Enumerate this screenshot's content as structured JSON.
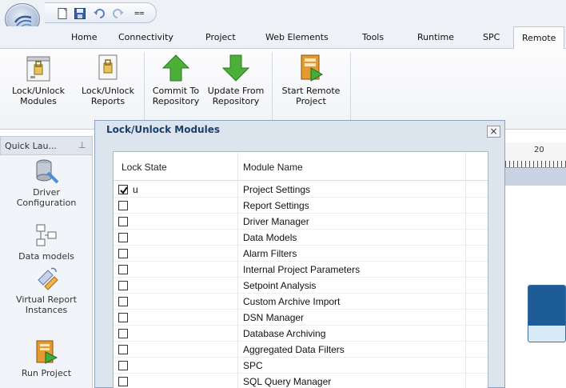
{
  "qat": {
    "icons": [
      "new-document-icon",
      "save-icon",
      "undo-icon",
      "redo-icon",
      "customize-dropdown-icon"
    ],
    "customize_glyph": "⩵"
  },
  "tabs": [
    {
      "label": "Home"
    },
    {
      "label": "Connectivity"
    },
    {
      "label": "Project"
    },
    {
      "label": "Web Elements"
    },
    {
      "label": "Tools"
    },
    {
      "label": "Runtime"
    },
    {
      "label": "SPC"
    },
    {
      "label": "Remote"
    }
  ],
  "ribbon": {
    "buttons": [
      {
        "line1": "Lock/Unlock",
        "line2": "Modules",
        "icon": "lock-modules-icon"
      },
      {
        "line1": "Lock/Unlock",
        "line2": "Reports",
        "icon": "lock-reports-icon"
      },
      {
        "line1": "Commit To",
        "line2": "Repository",
        "icon": "commit-up-arrow-icon"
      },
      {
        "line1": "Update From",
        "line2": "Repository",
        "icon": "update-down-arrow-icon"
      },
      {
        "line1": "Start Remote",
        "line2": "Project",
        "icon": "start-remote-project-icon"
      }
    ],
    "colors": {
      "arrow_green": "#4caf3a",
      "lock_gold": "#e8c25a"
    }
  },
  "quick_launch": {
    "title": "Quick Lau...",
    "pin_glyph": "⊥",
    "items": [
      {
        "line1": "Driver",
        "line2": "Configuration",
        "icon": "driver-configuration-icon"
      },
      {
        "line1": "Data models",
        "line2": "",
        "icon": "data-models-icon"
      },
      {
        "line1": "Virtual Report",
        "line2": "Instances",
        "icon": "virtual-report-instances-icon"
      },
      {
        "line1": "Run Project",
        "line2": "",
        "icon": "run-project-icon"
      }
    ]
  },
  "canvas": {
    "ruler_label": "20",
    "accent": "#1d5c96"
  },
  "dialog": {
    "title": "Lock/Unlock Modules",
    "close_glyph": "×",
    "columns": {
      "lock_state": "Lock State",
      "module_name": "Module Name"
    },
    "rows": [
      {
        "checked": true,
        "lock_text": "u",
        "name": "Project Settings"
      },
      {
        "checked": false,
        "lock_text": "",
        "name": "Report Settings"
      },
      {
        "checked": false,
        "lock_text": "",
        "name": "Driver Manager"
      },
      {
        "checked": false,
        "lock_text": "",
        "name": "Data Models"
      },
      {
        "checked": false,
        "lock_text": "",
        "name": "Alarm Filters"
      },
      {
        "checked": false,
        "lock_text": "",
        "name": "Internal Project Parameters"
      },
      {
        "checked": false,
        "lock_text": "",
        "name": "Setpoint Analysis"
      },
      {
        "checked": false,
        "lock_text": "",
        "name": "Custom Archive Import"
      },
      {
        "checked": false,
        "lock_text": "",
        "name": "DSN Manager"
      },
      {
        "checked": false,
        "lock_text": "",
        "name": "Database Archiving"
      },
      {
        "checked": false,
        "lock_text": "",
        "name": "Aggregated Data Filters"
      },
      {
        "checked": false,
        "lock_text": "",
        "name": "SPC"
      },
      {
        "checked": false,
        "lock_text": "",
        "name": "SQL Query Manager"
      }
    ]
  }
}
